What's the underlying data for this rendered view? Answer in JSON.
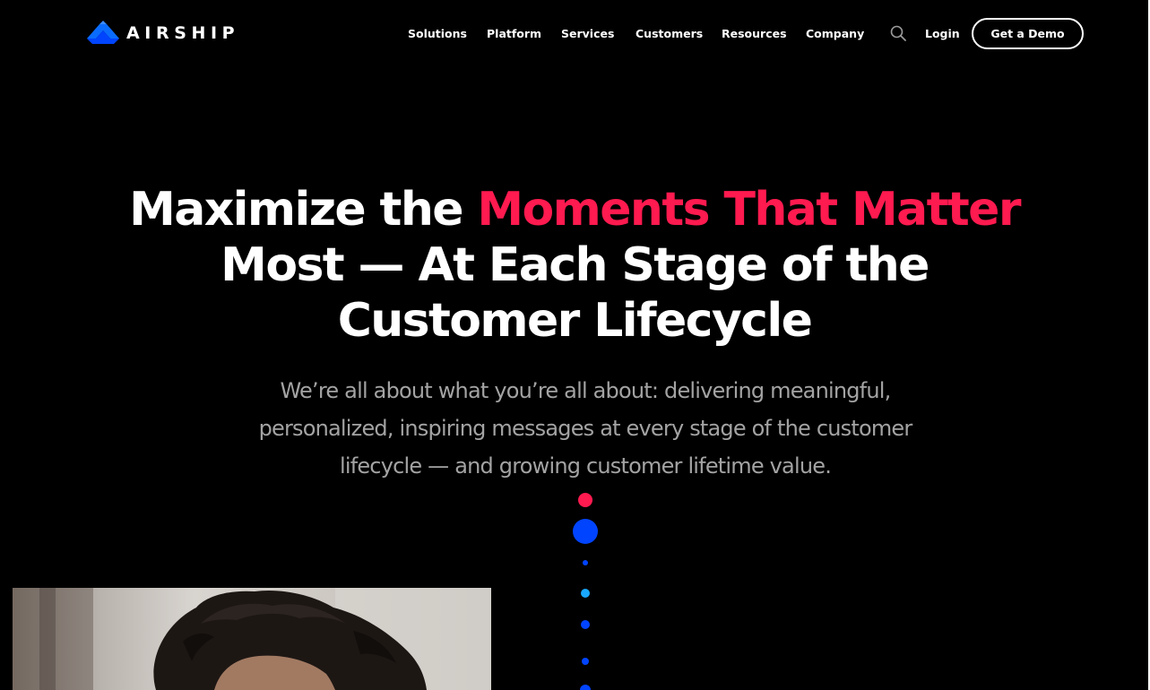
{
  "brand": {
    "name": "AIRSHIP",
    "logo_icon": "airship-logo-icon",
    "accent_color": "#ff1a4f",
    "brand_blue": "#0044ff"
  },
  "nav": {
    "items": [
      {
        "label": "Solutions"
      },
      {
        "label": "Platform"
      },
      {
        "label": "Services"
      },
      {
        "label": "Customers"
      },
      {
        "label": "Resources"
      },
      {
        "label": "Company"
      }
    ],
    "search_icon": "search-icon",
    "login_label": "Login",
    "demo_label": "Get a Demo"
  },
  "hero": {
    "title_lead": "Maximize the ",
    "title_highlight": "Moments That Matter",
    "title_line2": "Most — At Each Stage of the",
    "title_line3": "Customer Lifecycle",
    "subtitle_line1": "We’re all about what you’re all about: delivering meaningful,",
    "subtitle_line2": "personalized, inspiring messages at every stage of the customer",
    "subtitle_line3": "lifecycle — and growing customer lifetime value."
  },
  "decor": {
    "dot_colors": [
      "#ff1a4f",
      "#0044ff",
      "#0044ff",
      "#19a7ff",
      "#0044ff",
      "#0044ff",
      "#0044ff"
    ]
  },
  "photo": {
    "subject": "person-with-curly-hair-photo"
  }
}
